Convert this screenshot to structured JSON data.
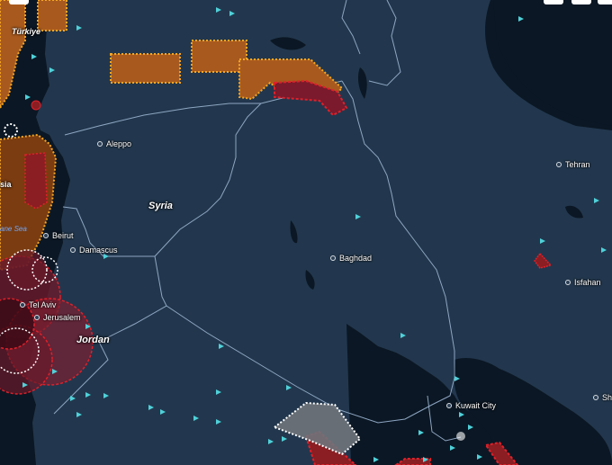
{
  "countries": {
    "turkiye": "Türkiye",
    "syria": "Syria",
    "jordan": "Jordan",
    "west_edge_partial": "sia"
  },
  "cities": {
    "aleppo": "Aleppo",
    "beirut": "Beirut",
    "damascus": "Damascus",
    "tel_aviv": "Tel Aviv",
    "jerusalem": "Jerusalem",
    "baghdad": "Baghdad",
    "tehran": "Tehran",
    "isfahan": "Isfahan",
    "kuwait_city": "Kuwait City",
    "shiraz_partial": "Shi"
  },
  "seas": {
    "mediterranean_partial": "ane Sea"
  },
  "colors": {
    "land": "#22374d",
    "water": "#0b1724",
    "border": "#8ea6c2",
    "zone_orange": "#a85a1e",
    "zone_orange_border": "#f5a623",
    "zone_red": "#e0202a",
    "zone_gray": "#8a8f96",
    "aircraft": "#4fd1d9"
  }
}
